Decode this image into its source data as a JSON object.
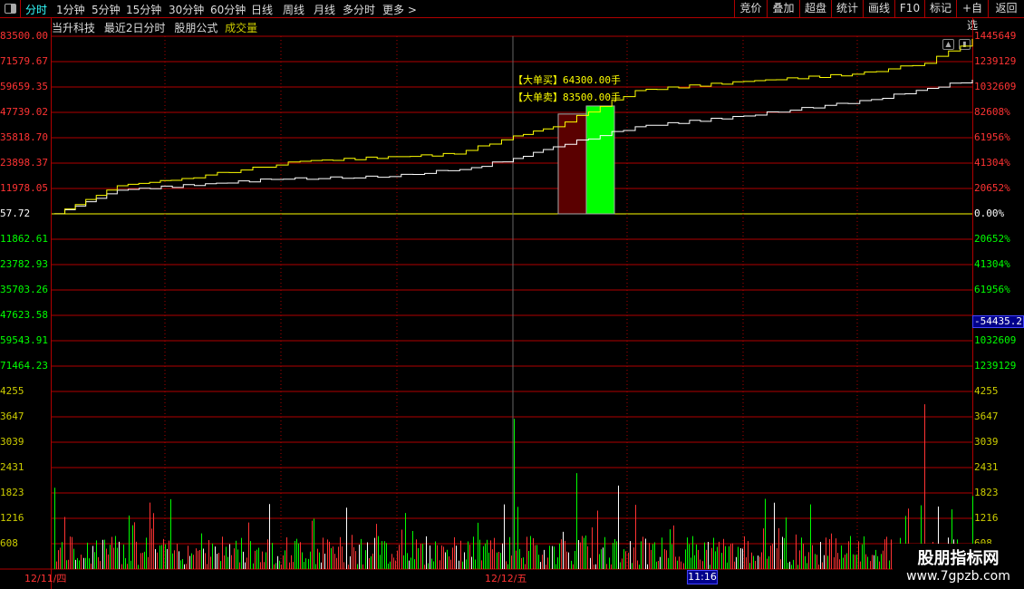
{
  "toolbar": {
    "periods": [
      "分时",
      "1分钟",
      "5分钟",
      "15分钟",
      "30分钟",
      "60分钟",
      "日线",
      "周线",
      "月线",
      "多分时",
      "更多 >"
    ],
    "active": "分时",
    "right_buttons": [
      "竞价",
      "叠加",
      "超盘",
      "统计",
      "画线",
      "F10",
      "标记",
      "+自选",
      "返回"
    ]
  },
  "title": {
    "stock": "当升科技",
    "mode": "最近2日分时",
    "formula": "股朋公式",
    "indicator": "成交量"
  },
  "axes": {
    "left_price": [
      "83500.00",
      "71579.67",
      "59659.35",
      "47739.02",
      "35818.70",
      "23898.37",
      "11978.05",
      "57.72",
      "11862.61",
      "23782.93",
      "35703.26",
      "47623.58",
      "59543.91",
      "71464.23"
    ],
    "right_pct": [
      "1445649",
      "1239129",
      "1032609",
      "82608%",
      "61956%",
      "41304%",
      "20652%",
      "0.00%",
      "20652%",
      "41304%",
      "61956%",
      "82608%",
      "1032609",
      "1239129"
    ],
    "volume": [
      "4255",
      "3647",
      "3039",
      "2431",
      "1823",
      "1216",
      "608"
    ],
    "dates": [
      "12/11/四",
      "12/12/五"
    ]
  },
  "cursor": {
    "value": "-54435.2",
    "time": "11:16"
  },
  "annotations": {
    "big_buy": "【大单买】64300.00手",
    "big_sell": "【大单卖】83500.00手"
  },
  "watermark": {
    "line1": "股朋指标网",
    "line2": "www.7gpzb.com"
  },
  "colors": {
    "grid": "#b00000",
    "price_line": "#ffff00",
    "avg_line": "#ffffff",
    "up": "#ff3333",
    "down": "#00ff00",
    "buy_bar": "#00ff00",
    "sell_bar": "#5a0000"
  },
  "chart_data": {
    "type": "line",
    "x_unit": "minute index (2 trading days)",
    "price_series": [
      [
        0,
        58
      ],
      [
        33,
        13200
      ],
      [
        67,
        16600
      ],
      [
        129,
        24700
      ],
      [
        210,
        28100
      ],
      [
        241,
        36600
      ],
      [
        262,
        40900
      ],
      [
        305,
        57900
      ],
      [
        362,
        62200
      ],
      [
        419,
        65600
      ],
      [
        457,
        70700
      ],
      [
        482,
        82200
      ]
    ],
    "avg_series": [
      [
        0,
        58
      ],
      [
        33,
        11100
      ],
      [
        114,
        16200
      ],
      [
        176,
        17500
      ],
      [
        219,
        21700
      ],
      [
        241,
        26000
      ],
      [
        262,
        31500
      ],
      [
        305,
        40900
      ],
      [
        362,
        46000
      ],
      [
        429,
        53700
      ],
      [
        482,
        63000
      ]
    ],
    "base": 57.72,
    "ylim": [
      -83500,
      83500
    ],
    "big_orders": {
      "sell": 83500,
      "buy": 64300
    },
    "volume_ylim": [
      0,
      4560
    ],
    "volume_spikes": [
      [
        0,
        1950
      ],
      [
        241,
        3600
      ],
      [
        274,
        2300
      ],
      [
        296,
        2000
      ],
      [
        457,
        3950
      ],
      [
        482,
        1750
      ]
    ]
  }
}
